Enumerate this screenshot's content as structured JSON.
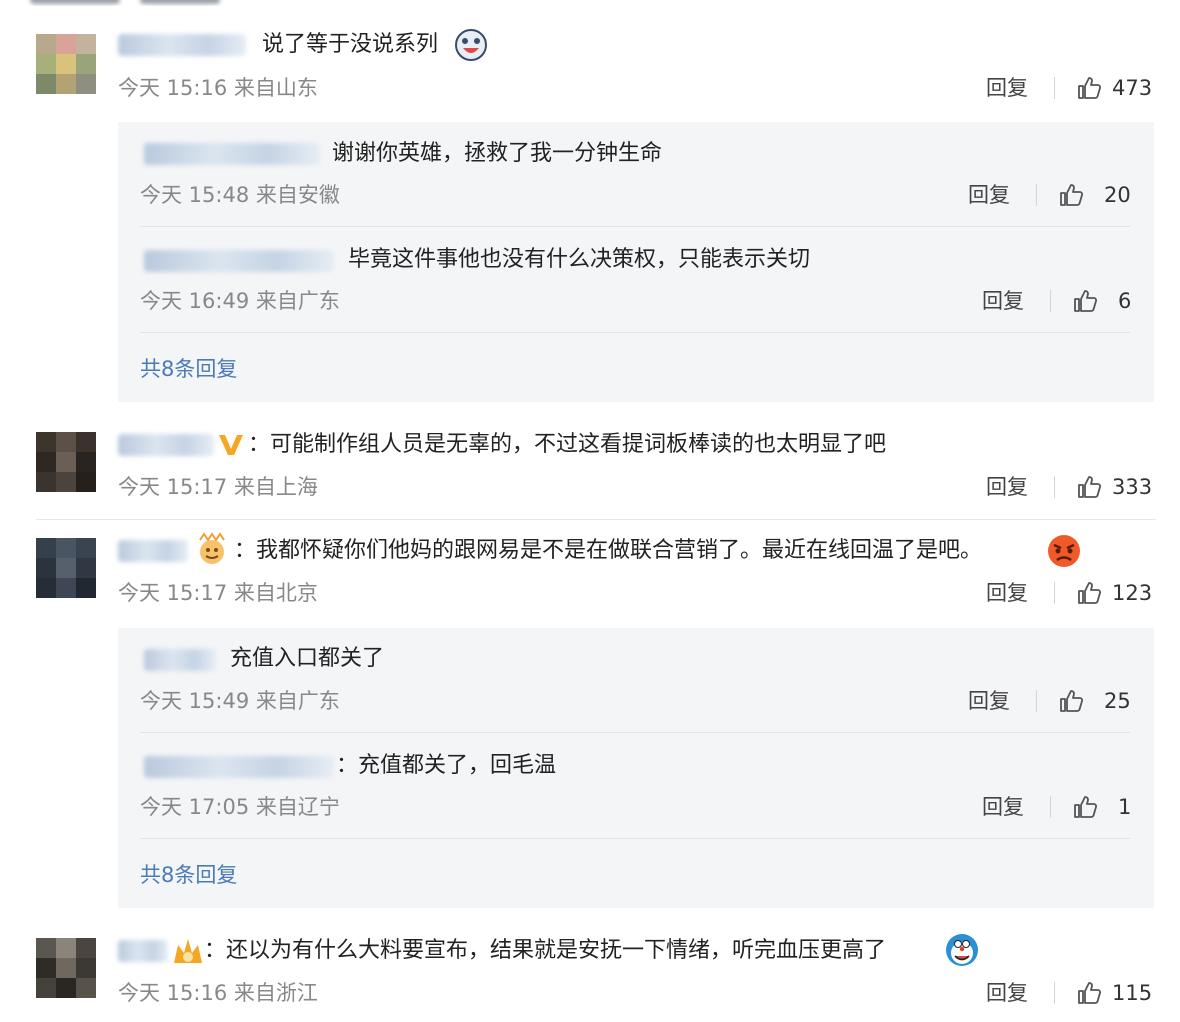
{
  "comments": [
    {
      "text": "说了等于没说系列",
      "time": "今天 15:16 来自山东",
      "reply_label": "回复",
      "likes": "473",
      "sub": {
        "replies": [
          {
            "text": "谢谢你英雄，拯救了我一分钟生命",
            "time": "今天 15:48 来自安徽",
            "reply_label": "回复",
            "likes": "20"
          },
          {
            "text": "毕竟这件事他也没有什么决策权，只能表示关切",
            "time": "今天 16:49 来自广东",
            "reply_label": "回复",
            "likes": "6"
          }
        ],
        "more": "共8条回复"
      }
    },
    {
      "text": "：可能制作组人员是无辜的，不过这看提词板棒读的也太明显了吧",
      "time": "今天 15:17 来自上海",
      "reply_label": "回复",
      "likes": "333"
    },
    {
      "text": "：我都怀疑你们他妈的跟网易是不是在做联合营销了。最近在线回温了是吧。",
      "time": "今天 15:17 来自北京",
      "reply_label": "回复",
      "likes": "123",
      "sub": {
        "replies": [
          {
            "text": "充值入口都关了",
            "time": "今天 15:49 来自广东",
            "reply_label": "回复",
            "likes": "25"
          },
          {
            "text": "：充值都关了，回毛温",
            "time": "今天 17:05 来自辽宁",
            "reply_label": "回复",
            "likes": "1"
          }
        ],
        "more": "共8条回复"
      }
    },
    {
      "text": "：还以为有什么大料要宣布，结果就是安抚一下情绪，听完血压更高了",
      "time": "今天 15:16 来自浙江",
      "reply_label": "回复",
      "likes": "115"
    }
  ],
  "icons": {
    "like": "thumbs-up-icon",
    "verified": "verified-v-icon"
  },
  "colors": {
    "link": "#4a7ab8",
    "meta": "#888888",
    "sub_bg": "#f4f5f7",
    "verified": "#f5a623"
  }
}
